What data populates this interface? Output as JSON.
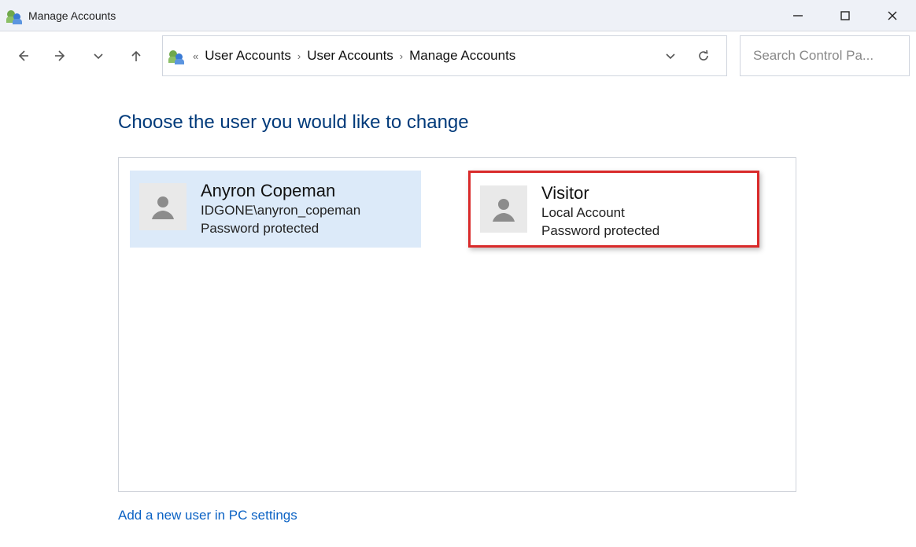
{
  "window": {
    "title": "Manage Accounts"
  },
  "breadcrumb": {
    "items": [
      "User Accounts",
      "User Accounts",
      "Manage Accounts"
    ]
  },
  "search": {
    "placeholder": "Search Control Pa..."
  },
  "main": {
    "heading": "Choose the user you would like to change",
    "add_user_link": "Add a new user in PC settings"
  },
  "accounts": [
    {
      "name": "Anyron Copeman",
      "line2": "IDGONE\\anyron_copeman",
      "line3": "Password protected",
      "selected": true,
      "highlighted": false
    },
    {
      "name": "Visitor",
      "line2": "Local Account",
      "line3": "Password protected",
      "selected": false,
      "highlighted": true
    }
  ]
}
